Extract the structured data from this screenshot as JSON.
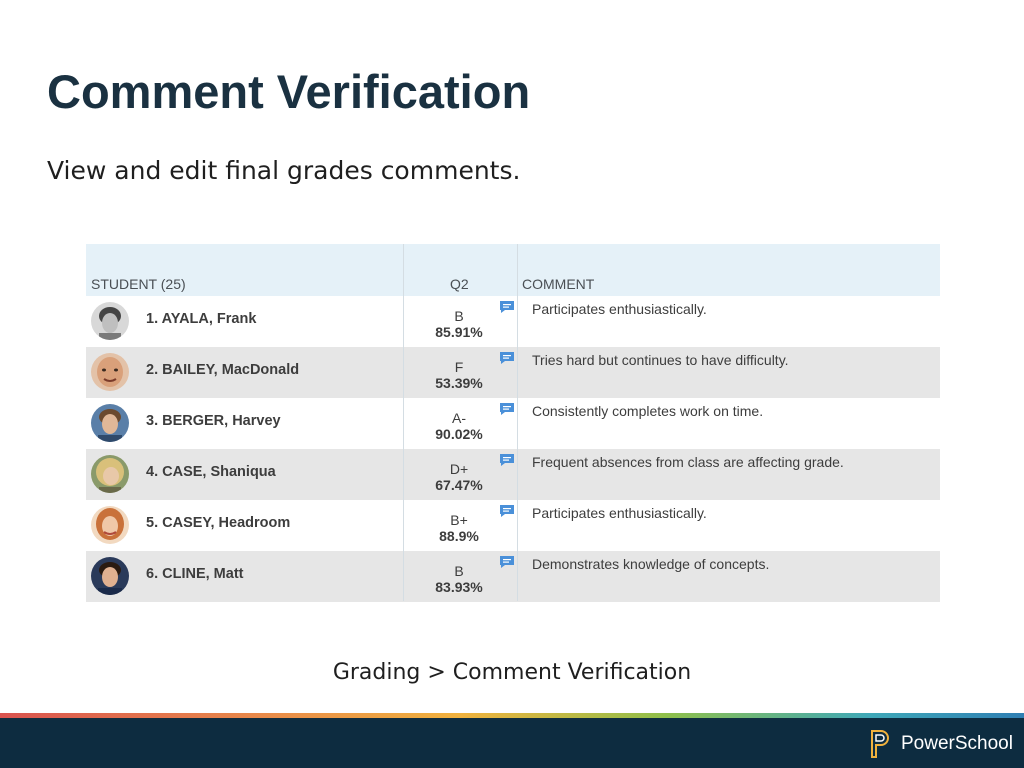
{
  "slide": {
    "title": "Comment Verification",
    "subtitle": "View and edit final grades comments."
  },
  "table": {
    "headers": {
      "student": "STUDENT (25)",
      "term": "Q2",
      "comment": "COMMENT"
    },
    "rows": [
      {
        "name": "1. AYALA, Frank",
        "grade": "B",
        "percent": "85.91%",
        "comment": "Participates enthusiastically."
      },
      {
        "name": "2. BAILEY, MacDonald",
        "grade": "F",
        "percent": "53.39%",
        "comment": "Tries hard but continues to have difficulty."
      },
      {
        "name": "3. BERGER, Harvey",
        "grade": "A-",
        "percent": "90.02%",
        "comment": "Consistently completes work on time."
      },
      {
        "name": "4. CASE, Shaniqua",
        "grade": "D+",
        "percent": "67.47%",
        "comment": "Frequent absences from class are affecting grade."
      },
      {
        "name": "5. CASEY, Headroom",
        "grade": "B+",
        "percent": "88.9%",
        "comment": "Participates enthusiastically."
      },
      {
        "name": "6. CLINE, Matt",
        "grade": "B",
        "percent": "83.93%",
        "comment": "Demonstrates knowledge of concepts."
      }
    ]
  },
  "breadcrumb": "Grading > Comment Verification",
  "footer": {
    "brand": "PowerSchool"
  },
  "colors": {
    "title": "#1a3141",
    "header_bg": "#e5f1f8",
    "row_alt": "#e6e6e6",
    "comment_icon": "#4a90d9",
    "footer_bg": "#0d2c40"
  },
  "icons": [
    "comment-icon",
    "powerschool-logo-icon"
  ]
}
